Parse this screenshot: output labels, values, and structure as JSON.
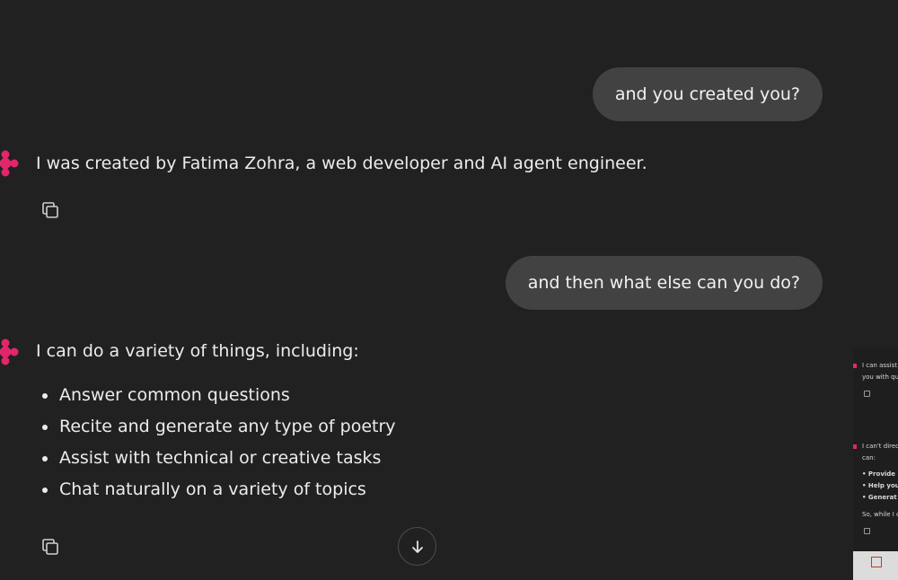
{
  "conversation": {
    "user_message_1": "and you created you?",
    "assistant_message_1": "I was created by Fatima Zohra, a web developer and AI agent engineer.",
    "user_message_2": "and then what else can you do?",
    "assistant_message_2_intro": "I can do a variety of things, including:",
    "assistant_message_2_items": [
      "Answer common questions",
      "Recite and generate any type of poetry",
      "Assist with technical or creative tasks",
      "Chat naturally on a variety of topics"
    ]
  },
  "thumbnail": {
    "line_1": "I can assist",
    "line_2": "you with qu",
    "line_3": "I can't direc",
    "line_4": "can:",
    "bullet_1": "Provide i",
    "bullet_2": "Help you",
    "bullet_3": "Generat",
    "line_5": "So, while I c"
  },
  "icons": {
    "assistant_logo": "assistant-logo-icon",
    "copy": "copy-icon",
    "scroll_down": "arrow-down-icon"
  },
  "colors": {
    "background": "#212121",
    "user_bubble": "#424242",
    "logo_accent": "#e3266b",
    "text": "#ececec"
  }
}
